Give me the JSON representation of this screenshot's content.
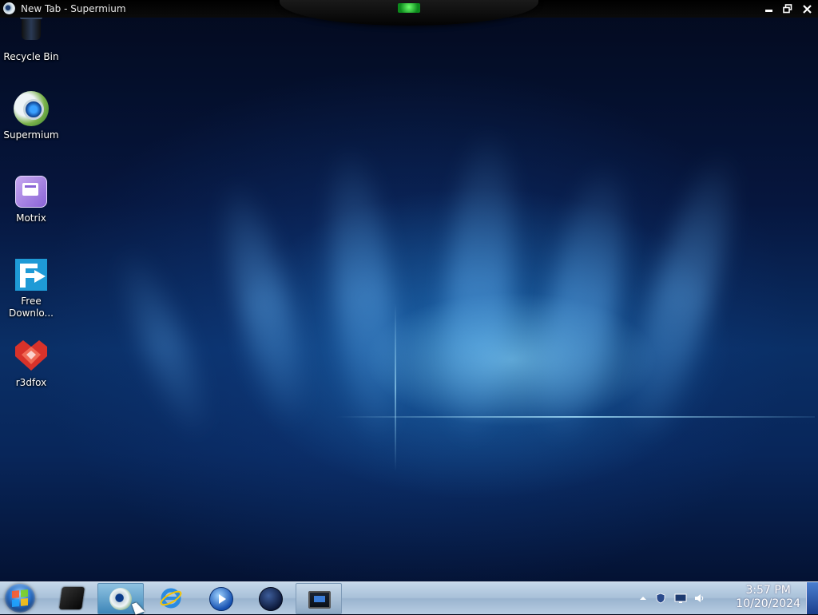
{
  "window": {
    "title": "New Tab - Supermium"
  },
  "desktop": {
    "icons": [
      {
        "label": "Recycle Bin",
        "icon": "recycle-bin-icon"
      },
      {
        "label": "Supermium",
        "icon": "supermium-browser-icon"
      },
      {
        "label": "Motrix",
        "icon": "motrix-icon"
      },
      {
        "label": "Free Downlo...",
        "icon": "free-download-manager-icon"
      },
      {
        "label": "r3dfox",
        "icon": "r3dfox-icon"
      }
    ]
  },
  "taskbar": {
    "start": "start-button",
    "pinned": [
      {
        "name": "terminal-app-icon"
      },
      {
        "name": "supermium-browser-icon",
        "state": "active"
      },
      {
        "name": "internet-explorer-icon"
      },
      {
        "name": "media-player-icon"
      },
      {
        "name": "globe-browser-icon"
      },
      {
        "name": "remote-desktop-icon",
        "state": "running"
      }
    ],
    "tray": [
      "show-hidden-icons-icon",
      "security-shield-icon",
      "network-icon",
      "volume-icon"
    ],
    "clock": {
      "time": "3:57 PM",
      "date": "10/20/2024"
    }
  },
  "colors": {
    "taskbar": "#a9c1d9",
    "active_button": "#3e86b8",
    "wallpaper_accent": "#1e6fb8"
  }
}
